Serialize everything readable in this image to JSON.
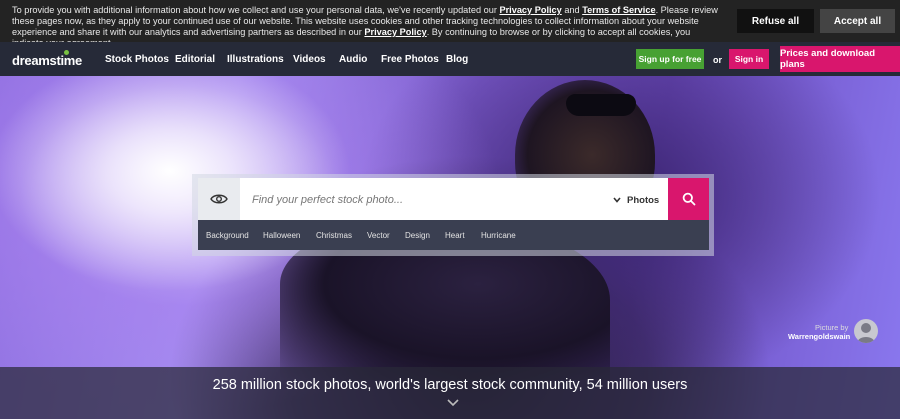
{
  "cookie_banner": {
    "text_1": "To provide you with additional information about how we collect and use your personal data, we've recently updated our ",
    "link_privacy": "Privacy Policy",
    "text_and": " and ",
    "link_terms": "Terms of Service",
    "text_2": ". Please review these pages now, as they apply to your continued use of our website. This website uses cookies and other tracking technologies to collect information about your website experience and share it with our analytics and advertising partners as described in our ",
    "link_privacy_2": "Privacy Policy",
    "text_3": ". By continuing to browse or by clicking to accept all cookies, you indicate your agreement.",
    "refuse_label": "Refuse all",
    "accept_label": "Accept all"
  },
  "nav": {
    "logo": "dreamstime",
    "items": [
      "Stock Photos",
      "Editorial",
      "Illustrations",
      "Videos",
      "Audio",
      "Free Photos",
      "Blog"
    ],
    "signup_label": "Sign up for free",
    "or_label": "or",
    "signin_label": "Sign in",
    "prices_label": "Prices and download plans"
  },
  "search": {
    "placeholder": "Find your perfect stock photo...",
    "type_label": "Photos",
    "tags": [
      "Background",
      "Halloween",
      "Christmas",
      "Vector",
      "Design",
      "Heart",
      "Hurricane"
    ]
  },
  "credit": {
    "label": "Picture by",
    "name": "Warrengoldswain"
  },
  "stats": {
    "text": "258 million stock photos, world's largest stock community, 54 million users"
  },
  "icons": {
    "eye": "eye-icon",
    "search": "search-icon",
    "chevron": "chevron-down-icon"
  },
  "colors": {
    "accent_pink": "#d9166d",
    "signup_green": "#47a133",
    "nav_bg": "#262a38",
    "banner_bg": "#232323"
  }
}
